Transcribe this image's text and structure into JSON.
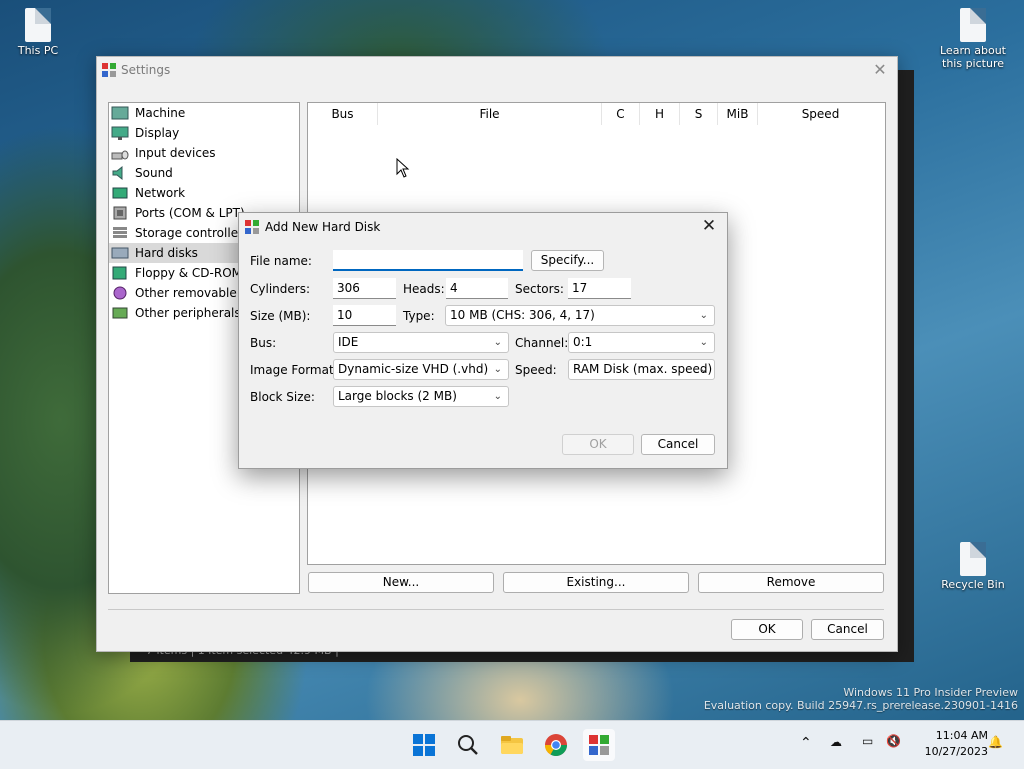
{
  "desktop": {
    "icons": [
      {
        "label": "This PC"
      },
      {
        "label": "Learn about this picture"
      },
      {
        "label": "Recycle Bin"
      }
    ],
    "watermark": {
      "line1": "Windows 11 Pro Insider Preview",
      "line2": "Evaluation copy. Build 25947.rs_prerelease.230901-1416"
    },
    "background_status": "7 items  |  1 item selected  42.9 MB  |"
  },
  "settings": {
    "title": "Settings",
    "nav": [
      {
        "label": "Machine"
      },
      {
        "label": "Display"
      },
      {
        "label": "Input devices"
      },
      {
        "label": "Sound"
      },
      {
        "label": "Network"
      },
      {
        "label": "Ports (COM & LPT)"
      },
      {
        "label": "Storage controllers"
      },
      {
        "label": "Hard disks",
        "selected": true
      },
      {
        "label": "Floppy & CD-ROM drives"
      },
      {
        "label": "Other removable devices"
      },
      {
        "label": "Other peripherals"
      }
    ],
    "table_headers": [
      "Bus",
      "File",
      "C",
      "H",
      "S",
      "MiB",
      "Speed"
    ],
    "buttons": {
      "new": "New...",
      "existing": "Existing...",
      "remove": "Remove"
    },
    "ok": "OK",
    "cancel": "Cancel"
  },
  "dialog": {
    "title": "Add New Hard Disk",
    "file_name_label": "File name:",
    "file_name_value": "",
    "specify": "Specify...",
    "cylinders_label": "Cylinders:",
    "cylinders_value": "306",
    "heads_label": "Heads:",
    "heads_value": "4",
    "sectors_label": "Sectors:",
    "sectors_value": "17",
    "size_label": "Size (MB):",
    "size_value": "10",
    "type_label": "Type:",
    "type_value": "10 MB (CHS: 306, 4, 17)",
    "bus_label": "Bus:",
    "bus_value": "IDE",
    "channel_label": "Channel:",
    "channel_value": "0:1",
    "format_label": "Image Format:",
    "format_value": "Dynamic-size VHD (.vhd)",
    "speed_label": "Speed:",
    "speed_value": "RAM Disk (max. speed)",
    "block_label": "Block Size:",
    "block_value": "Large blocks (2 MB)",
    "ok": "OK",
    "cancel": "Cancel"
  },
  "taskbar": {
    "time": "11:04 AM",
    "date": "10/27/2023"
  },
  "colors": {
    "accent": "#0067c0",
    "selection": "#d9d9d9"
  }
}
